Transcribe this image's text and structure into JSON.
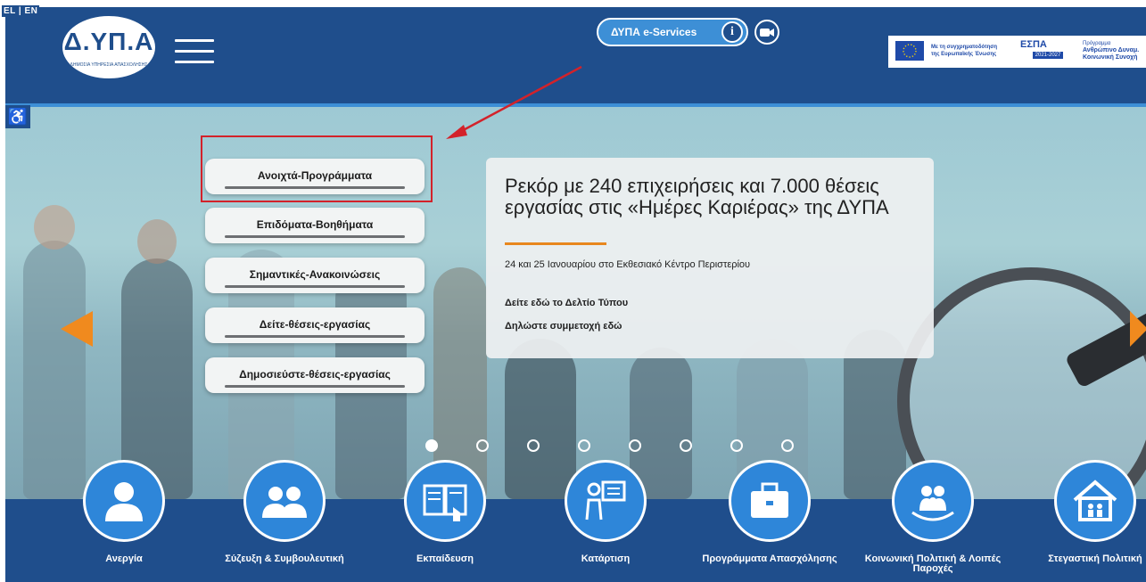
{
  "lang_switch": "EL | EN",
  "logo": {
    "text": "Δ.ΥΠ.Α",
    "subtitle": "ΔΗΜΟΣΙΑ ΥΠΗΡΕΣΙΑ ΑΠΑΣΧΟΛΗΣΗΣ"
  },
  "header": {
    "eservices_label": "ΔΥΠΑ e-Services",
    "info_label": "i",
    "espa": {
      "cofund_text": "Με τη συγχρηματοδότηση της Ευρωπαϊκής Ένωσης",
      "logo_title": "ΕΣΠΑ",
      "logo_years": "2021-2027",
      "program_small": "Πρόγραμμα",
      "program_name": "Ανθρώπινο Δυναμ. Κοινωνική Συνοχή"
    }
  },
  "program_buttons": [
    {
      "label": "Ανοιχτά-Προγράμματα"
    },
    {
      "label": "Επιδόματα-Βοηθήματα"
    },
    {
      "label": "Σημαντικές-Ανακοινώσεις"
    },
    {
      "label": "Δείτε-θέσεις-εργασίας"
    },
    {
      "label": "Δημοσιεύστε-θέσεις-εργασίας"
    }
  ],
  "news": {
    "title": "Ρεκόρ με 240 επιχειρήσεις και 7.000 θέσεις εργασίας στις «Ημέρες Καριέρας» της ΔΥΠΑ",
    "subtitle": "24 και 25 Ιανουαρίου στο Εκθεσιακό Κέντρο Περιστερίου",
    "link1": "Δείτε εδώ το Δελτίο Τύπου",
    "link2": "Δηλώστε συμμετοχή εδώ"
  },
  "carousel": {
    "slide_count": 8,
    "active_index": 0
  },
  "bottom_nav": [
    {
      "label": "Ανεργία",
      "icon": "person-icon"
    },
    {
      "label": "Σύζευξη & Συμβουλευτική",
      "icon": "people-icon"
    },
    {
      "label": "Εκπαίδευση",
      "icon": "book-icon"
    },
    {
      "label": "Κατάρτιση",
      "icon": "teacher-board-icon"
    },
    {
      "label": "Προγράμματα Απασχόλησης",
      "icon": "briefcase-icon"
    },
    {
      "label": "Κοινωνική Πολιτική & Λοιπές Παροχές",
      "icon": "family-hands-icon"
    },
    {
      "label": "Στεγαστική Πολιτική",
      "icon": "house-family-icon"
    }
  ],
  "colors": {
    "header_blue": "#1f4e8c",
    "icon_blue": "#2e86d9",
    "accent_orange": "#f08a1e",
    "annotation_red": "#d3222a"
  }
}
